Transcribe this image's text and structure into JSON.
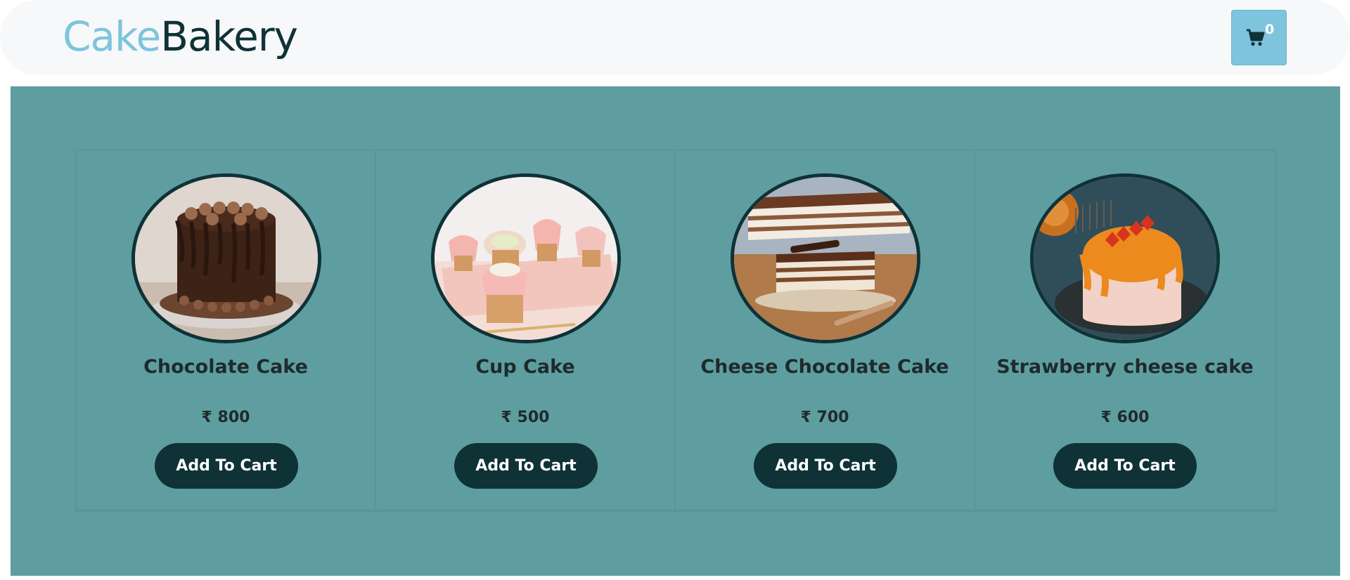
{
  "header": {
    "logo_part1": "Cake",
    "logo_part2": "Bakery",
    "cart_icon": "shopping-cart-icon",
    "cart_count": "0"
  },
  "colors": {
    "accent": "#7ec4dc",
    "dark": "#0f3236",
    "panel": "#5e9ea0",
    "navbar": "#f7f8f9"
  },
  "products": [
    {
      "name": "Chocolate Cake",
      "price": "₹ 800",
      "button": "Add To Cart",
      "image": "chocolate-cake-image"
    },
    {
      "name": "Cup Cake",
      "price": "₹ 500",
      "button": "Add To Cart",
      "image": "cupcake-image"
    },
    {
      "name": "Cheese Chocolate Cake",
      "price": "₹ 700",
      "button": "Add To Cart",
      "image": "cheese-chocolate-cake-image"
    },
    {
      "name": "Strawberry cheese cake",
      "price": "₹ 600",
      "button": "Add To Cart",
      "image": "strawberry-cheese-cake-image"
    }
  ]
}
